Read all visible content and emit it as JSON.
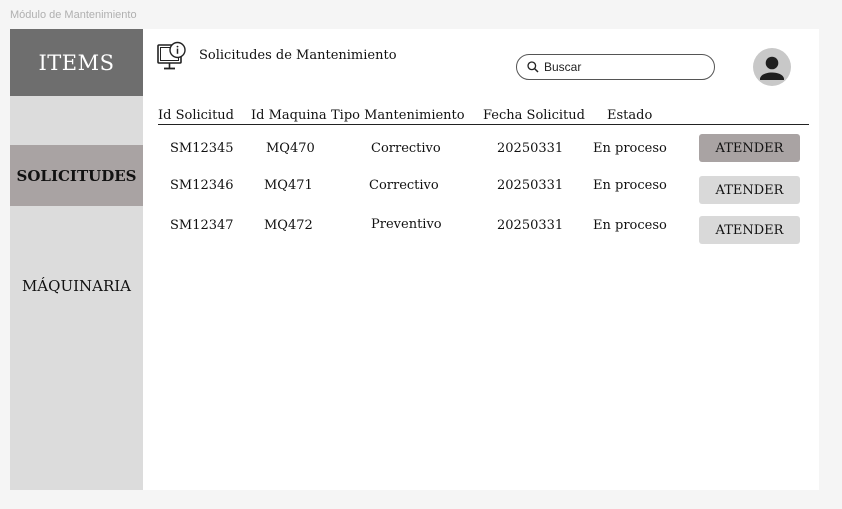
{
  "frame_label": "Módulo de Mantenimiento",
  "sidebar": {
    "logo": "ITEMS",
    "items": [
      {
        "label": "SOLICITUDES"
      },
      {
        "label": "MÁQUINARIA"
      }
    ]
  },
  "header": {
    "title": "Solicitudes de Mantenimiento",
    "search_placeholder": "Buscar"
  },
  "table": {
    "columns": [
      "Id Solicitud",
      "Id Maquina",
      "Tipo Mantenimiento",
      "Fecha Solicitud",
      "Estado"
    ],
    "rows": [
      {
        "id": "SM12345",
        "maquina": "MQ470",
        "tipo": "Correctivo",
        "fecha": "20250331",
        "estado": "En proceso",
        "action": "ATENDER"
      },
      {
        "id": "SM12346",
        "maquina": "MQ471",
        "tipo": "Correctivo",
        "fecha": "20250331",
        "estado": "En proceso",
        "action": "ATENDER"
      },
      {
        "id": "SM12347",
        "maquina": "MQ472",
        "tipo": "Preventivo",
        "fecha": "20250331",
        "estado": "En proceso",
        "action": "ATENDER"
      }
    ]
  },
  "colors": {
    "logo_bg": "#6e6e6e",
    "sidebar_bg": "#dcdcdc",
    "active_item_bg": "#a9a3a3",
    "button_bg": "#d9d9d9"
  },
  "icons": [
    "monitor-info-icon",
    "search-icon",
    "user-avatar-icon"
  ]
}
